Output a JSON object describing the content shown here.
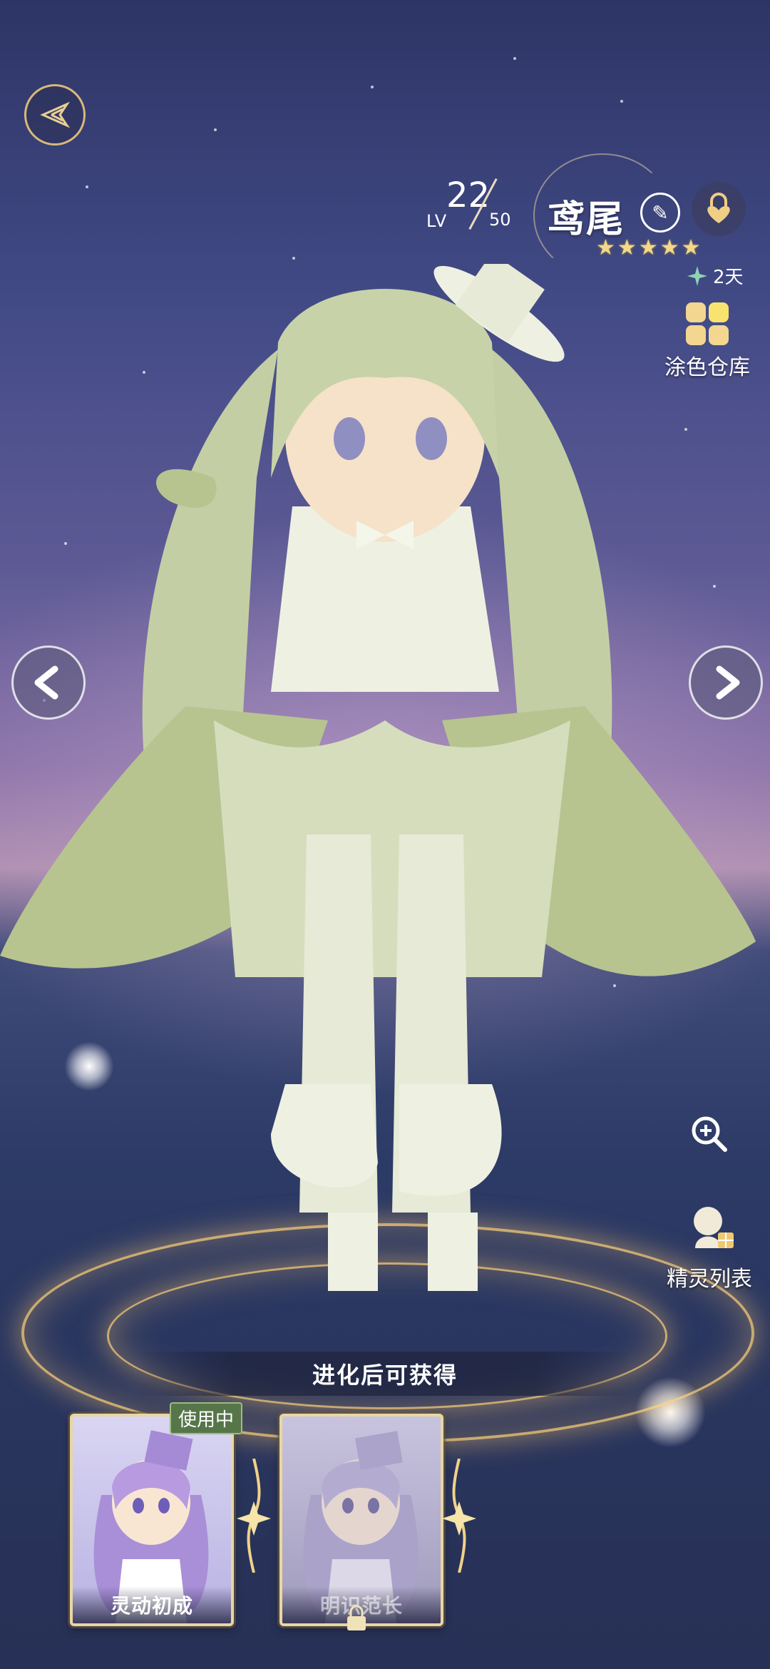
{
  "character": {
    "name": "鸢尾",
    "level_label": "LV",
    "level": "22",
    "max_level": "50",
    "stars": 5,
    "star_glyph": "★",
    "duration": "2天"
  },
  "sidebar": {
    "warehouse_label": "涂色仓库",
    "spirit_list_label": "精灵列表"
  },
  "evolution": {
    "banner_text": "进化后可获得",
    "in_use_badge": "使用中",
    "forms": [
      {
        "name": "灵动初成",
        "status": "in-use"
      },
      {
        "name": "明识范长",
        "status": "locked"
      }
    ]
  },
  "colors": {
    "accent_gold": "#d8b978",
    "dress_green": "#b7c48f",
    "star": "#f1d88a"
  },
  "icons": {
    "back": "winged-back-icon",
    "prev": "chevron-left-icon",
    "next": "chevron-right-icon",
    "edit": "edit-icon",
    "lock": "heart-lock-icon",
    "duration": "clover-icon",
    "warehouse": "palette-grid-icon",
    "zoom": "zoom-in-icon",
    "spirit_list": "spirit-list-icon"
  }
}
